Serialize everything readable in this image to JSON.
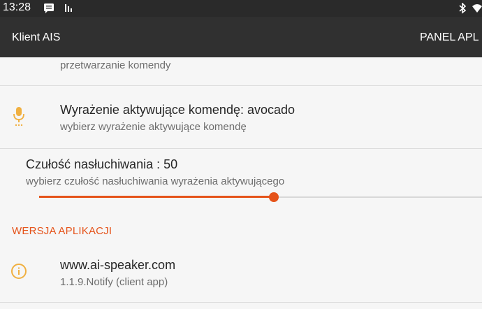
{
  "status_bar": {
    "time": "13:28",
    "icons": [
      "message-icon",
      "signal-icon",
      "bluetooth-icon",
      "wifi-icon"
    ]
  },
  "app_bar": {
    "title": "Klient AIS",
    "action_label": "PANEL APL"
  },
  "settings": {
    "command_processing_summary": "przetwarzanie komendy",
    "hotword": {
      "title": "Wyrażenie aktywujące komendę: avocado",
      "summary": "wybierz wyrażenie aktywujące komendę",
      "icon": "microphone-icon"
    },
    "sensitivity": {
      "title": "Czułość nasłuchiwania : 50",
      "summary": "wybierz czułość nasłuchiwania wyrażenia aktywującego",
      "value": 50,
      "max": 100
    },
    "version_section": {
      "header": "WERSJA APLIKACJI",
      "title": "www.ai-speaker.com",
      "summary": "1.1.9.Notify (client app)",
      "icon": "info-icon"
    }
  },
  "colors": {
    "accent": "#e5531a",
    "icon_amber": "#f0b041",
    "app_bar": "#303030",
    "status_bar": "#2a2a2a",
    "background": "#f6f6f6"
  }
}
